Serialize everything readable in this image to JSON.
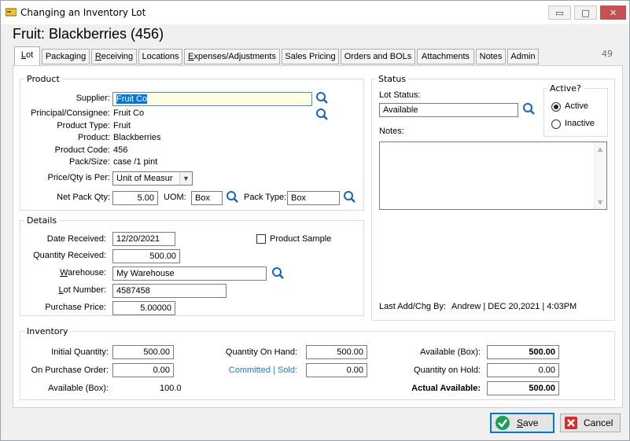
{
  "window": {
    "title": "Changing an Inventory Lot",
    "minimize": "▭",
    "maximize": "□",
    "close": "✕"
  },
  "heading": "Fruit: Blackberries (456)",
  "tabs": [
    {
      "label": "Lot",
      "u": "L",
      "rest": "ot"
    },
    {
      "label": "Packaging",
      "u": "",
      "rest": "Packaging"
    },
    {
      "label": "Receiving",
      "u": "R",
      "rest": "eceiving"
    },
    {
      "label": "Locations",
      "u": "",
      "rest": "Locations"
    },
    {
      "label": "Expenses/Adjustments",
      "u": "E",
      "rest": "xpenses/Adjustments"
    },
    {
      "label": "Sales Pricing",
      "u": "",
      "rest": "Sales Pricing"
    },
    {
      "label": "Orders and BOLs",
      "u": "",
      "rest": "Orders and BOLs"
    },
    {
      "label": "Attachments",
      "u": "",
      "rest": "Attachments"
    },
    {
      "label": "Notes",
      "u": "",
      "rest": "Notes"
    },
    {
      "label": "Admin",
      "u": "",
      "rest": "Admin"
    }
  ],
  "counter": "49",
  "product": {
    "title": "Product",
    "supplier_label": "Supplier:",
    "supplier_value": "Fruit Co",
    "principal_label": "Principal/Consignee:",
    "principal_value": "Fruit Co",
    "product_type_label": "Product Type:",
    "product_type_value": "Fruit",
    "product_label": "Product:",
    "product_value": "Blackberries",
    "product_code_label": "Product Code:",
    "product_code_value": "456",
    "pack_size_label": "Pack/Size:",
    "pack_size_value": "case /1 pint",
    "price_qty_label": "Price/Qty is Per:",
    "price_qty_value": "Unit of Measur",
    "net_pack_label": "Net Pack Qty:",
    "net_pack_value": "5.00",
    "uom_label": "UOM:",
    "uom_value": "Box",
    "pack_type_label": "Pack Type:",
    "pack_type_value": "Box"
  },
  "details": {
    "title": "Details",
    "date_label": "Date Received:",
    "date_value": "12/20/2021",
    "qty_label": "Quantity Received:",
    "qty_value": "500.00",
    "warehouse_label": "Warehouse:",
    "warehouse_value": "My Warehouse",
    "lot_label": "Lot Number:",
    "lot_value": "4587458",
    "price_label": "Purchase Price:",
    "price_value": "5.00000",
    "sample_label": "Product Sample"
  },
  "status": {
    "title": "Status",
    "lot_status_label": "Lot Status:",
    "lot_status_value": "Available",
    "active_title": "Active?",
    "active_label": "Active",
    "inactive_label": "Inactive",
    "notes_label": "Notes:",
    "last_chg_label": "Last Add/Chg By:",
    "last_chg_value": "Andrew | DEC 20,2021 |  4:03PM"
  },
  "inventory": {
    "title": "Inventory",
    "initial_label": "Initial Quantity:",
    "initial_value": "500.00",
    "on_po_label": "On Purchase Order:",
    "on_po_value": "0.00",
    "avail_box_label": "Available (Box):",
    "avail_box_value": "100.0",
    "on_hand_label": "Quantity On Hand:",
    "on_hand_value": "500.00",
    "committed_label": "Committed | Sold:",
    "committed_value": "0.00",
    "avail_box2_label": "Available (Box):",
    "avail_box2_value": "500.00",
    "on_hold_label": "Quantity on Hold:",
    "on_hold_value": "0.00",
    "actual_label": "Actual Available:",
    "actual_value": "500.00"
  },
  "buttons": {
    "save_u": "S",
    "save_rest": "ave",
    "cancel": "Cancel"
  },
  "colors": {
    "accent": "#0078d7",
    "link": "#1e79d6",
    "close_red": "#c75050",
    "save_green": "#1f9d55",
    "cancel_red": "#d32f2f"
  }
}
